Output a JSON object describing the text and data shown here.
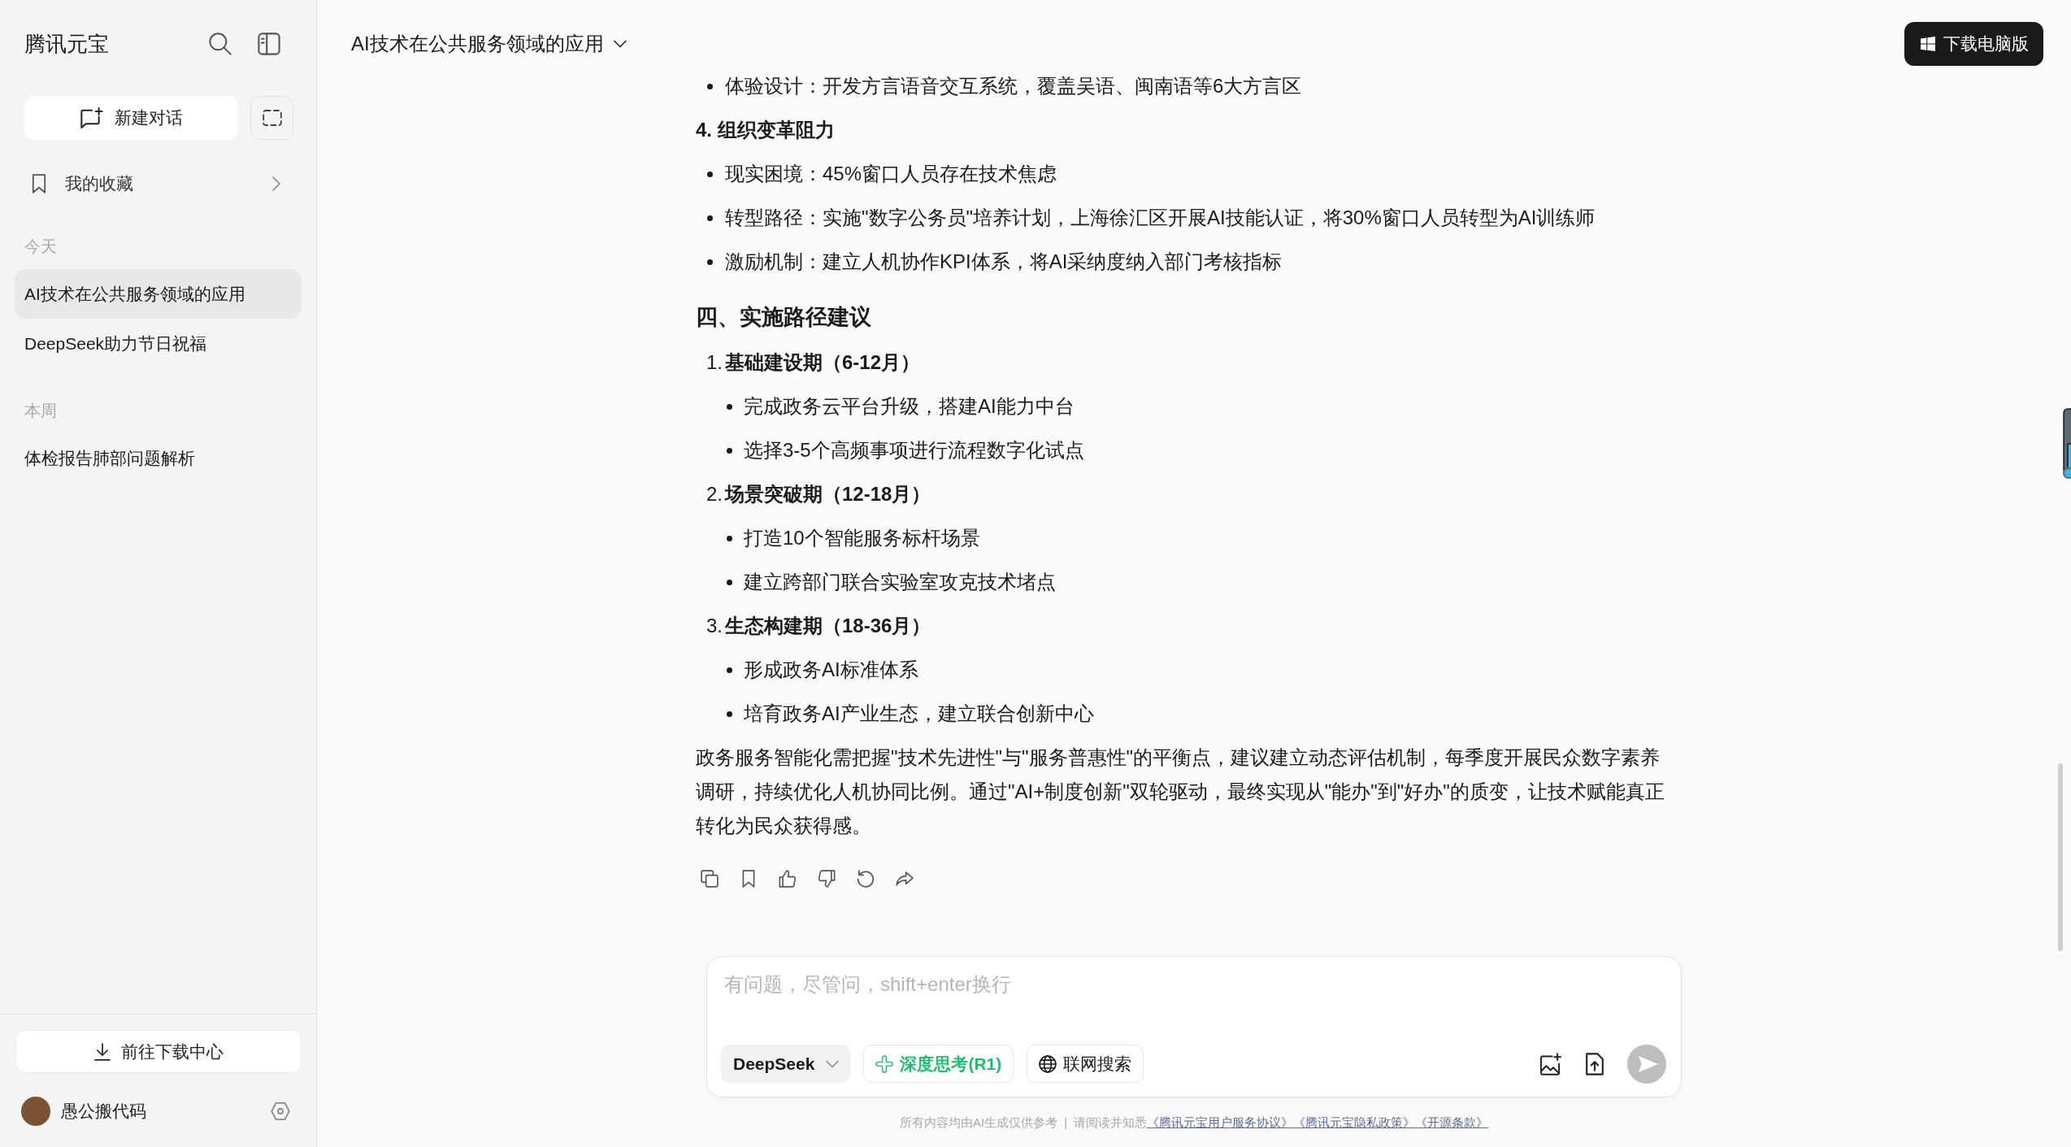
{
  "sidebar": {
    "logo": "腾讯元宝",
    "new_chat": "新建对话",
    "favorites": "我的收藏",
    "groups": [
      {
        "label": "今天",
        "items": [
          {
            "title": "AI技术在公共服务领域的应用",
            "selected": true
          },
          {
            "title": "DeepSeek助力节日祝福",
            "selected": false
          }
        ]
      },
      {
        "label": "本周",
        "items": [
          {
            "title": "体检报告肺部问题解析",
            "selected": false
          }
        ]
      }
    ],
    "download_center": "前往下载中心",
    "user": {
      "name": "愚公搬代码"
    }
  },
  "header": {
    "title": "AI技术在公共服务领域的应用",
    "download_button": "下载电脑版"
  },
  "message": {
    "blocks": [
      {
        "kind": "bullet",
        "text": "体验设计：开发方言语音交互系统，覆盖吴语、闽南语等6大方言区"
      },
      {
        "kind": "subheading",
        "text": "4. 组织变革阻力"
      },
      {
        "kind": "bullet",
        "text": "现实困境：45%窗口人员存在技术焦虑"
      },
      {
        "kind": "bullet",
        "text": "转型路径：实施\"数字公务员\"培养计划，上海徐汇区开展AI技能认证，将30%窗口人员转型为AI训练师"
      },
      {
        "kind": "bullet",
        "text": "激励机制：建立人机协作KPI体系，将AI采纳度纳入部门考核指标"
      },
      {
        "kind": "heading",
        "text": "四、实施路径建议"
      },
      {
        "kind": "numbered",
        "number": "1.",
        "text": "基础建设期（6-12月）",
        "children": [
          {
            "text": "完成政务云平台升级，搭建AI能力中台"
          },
          {
            "text": "选择3-5个高频事项进行流程数字化试点"
          }
        ]
      },
      {
        "kind": "numbered",
        "number": "2.",
        "text": "场景突破期（12-18月）",
        "children": [
          {
            "text": "打造10个智能服务标杆场景"
          },
          {
            "text": "建立跨部门联合实验室攻克技术堵点"
          }
        ]
      },
      {
        "kind": "numbered",
        "number": "3.",
        "text": "生态构建期（18-36月）",
        "children": [
          {
            "text": "形成政务AI标准体系"
          },
          {
            "text": "培育政务AI产业生态，建立联合创新中心"
          }
        ]
      },
      {
        "kind": "paragraph",
        "text": "政务服务智能化需把握\"技术先进性\"与\"服务普惠性\"的平衡点，建议建立动态评估机制，每季度开展民众数字素养调研，持续优化人机协同比例。通过\"AI+制度创新\"双轮驱动，最终实现从\"能办\"到\"好办\"的质变，让技术赋能真正转化为民众获得感。"
      }
    ]
  },
  "composer": {
    "placeholder": "有问题，尽管问，shift+enter换行",
    "model": "DeepSeek",
    "options": [
      {
        "kind": "deep_think",
        "label": "深度思考(R1)",
        "on": true
      },
      {
        "kind": "web_search",
        "label": "联网搜索",
        "on": false
      }
    ],
    "send_disabled": true
  },
  "footer": {
    "disclaimer": "所有内容均由AI生成仅供参考",
    "separator": "|",
    "notice": "请阅读并知悉",
    "links": [
      "《腾讯元宝用户服务协议》",
      "《腾讯元宝隐私政策》",
      "《开源条款》"
    ]
  }
}
